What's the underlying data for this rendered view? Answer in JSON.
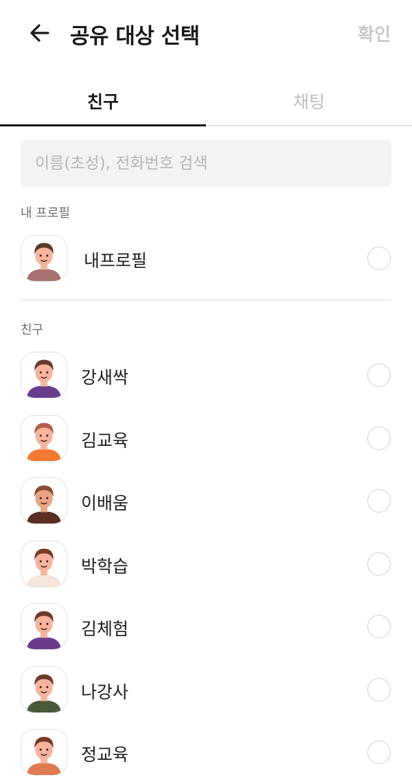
{
  "header": {
    "title": "공유 대상 선택",
    "confirm_label": "확인"
  },
  "tabs": [
    {
      "label": "친구",
      "active": true
    },
    {
      "label": "채팅",
      "active": false
    }
  ],
  "search": {
    "placeholder": "이름(초성), 전화번호 검색",
    "value": ""
  },
  "my_profile": {
    "section_label": "내 프로필",
    "name": "내프로필",
    "avatar": {
      "shirt": "#a87070",
      "hair": "#5a3a2a",
      "skin": "#f6b49c"
    }
  },
  "friends": {
    "section_label": "친구",
    "items": [
      {
        "name": "강새싹",
        "avatar": {
          "shirt": "#6a3d8c",
          "hair": "#6b3a2a",
          "skin": "#f6b49c"
        }
      },
      {
        "name": "김교육",
        "avatar": {
          "shirt": "#f37a30",
          "hair": "#b25b48",
          "skin": "#f6b49c"
        }
      },
      {
        "name": "이배움",
        "avatar": {
          "shirt": "#5a2e22",
          "hair": "#8a4a34",
          "skin": "#e8a484"
        }
      },
      {
        "name": "박학습",
        "avatar": {
          "shirt": "#f5e6dc",
          "hair": "#7a3a24",
          "skin": "#f6b49c"
        }
      },
      {
        "name": "김체험",
        "avatar": {
          "shirt": "#6a3d8c",
          "hair": "#6b3a2a",
          "skin": "#f6b49c"
        }
      },
      {
        "name": "나강사",
        "avatar": {
          "shirt": "#4a5a3a",
          "hair": "#6b3a2a",
          "skin": "#f6b49c"
        }
      },
      {
        "name": "정교육",
        "avatar": {
          "shirt": "#e07a50",
          "hair": "#7a3a24",
          "skin": "#f6b49c"
        }
      }
    ]
  }
}
